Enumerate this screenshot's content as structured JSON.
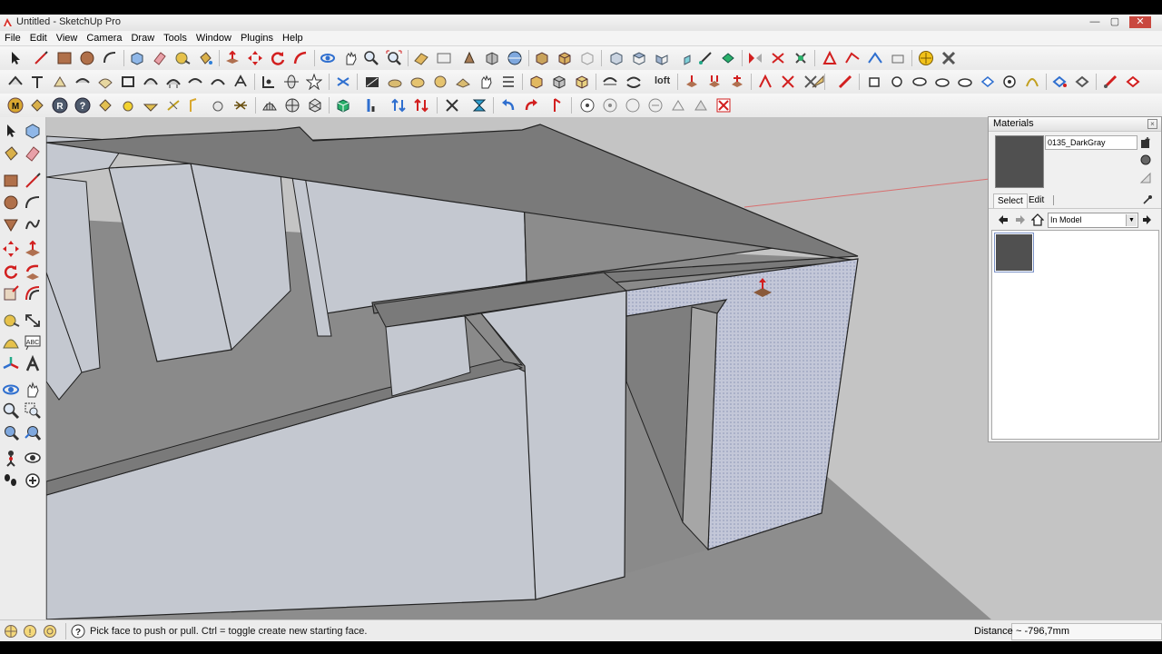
{
  "window": {
    "title": "Untitled - SketchUp Pro",
    "minimize": "—",
    "maximize": "▢",
    "close": "✕"
  },
  "menu": [
    "File",
    "Edit",
    "View",
    "Camera",
    "Draw",
    "Tools",
    "Window",
    "Plugins",
    "Help"
  ],
  "toolbar": {
    "loft_label": "loft"
  },
  "materials_panel": {
    "title": "Materials",
    "material_name": "0135_DarkGray",
    "tabs": [
      "Select",
      "Edit"
    ],
    "collection": "In Model",
    "swatch_color": "#505050"
  },
  "statusbar": {
    "hint": "Pick face to push or pull.  Ctrl = toggle create new starting face.",
    "measure_label": "Distance",
    "measure_value": "~ -796,7mm"
  },
  "colors": {
    "accent_red": "#d21f1f",
    "accent_blue": "#2f6fcf",
    "wall_face": "#c4c8d0",
    "floor": "#8c8c8c",
    "selected_face": "#c3c7d8"
  },
  "icons": {
    "toolbar_row1": [
      "select-icon",
      "line-icon",
      "rectangle-icon",
      "circle-icon",
      "arc-icon",
      "make-component-icon",
      "eraser-icon",
      "tape-measure-icon",
      "paint-bucket-icon",
      "push-pull-icon",
      "move-icon",
      "rotate-icon",
      "follow-me-icon",
      "orbit-icon",
      "pan-icon",
      "zoom-icon",
      "zoom-extents-icon",
      "section-icon",
      "scene-icon",
      "styles-icon",
      "components-icon",
      "shadows-icon",
      "fog-icon",
      "views-icon",
      "sandbox-icon",
      "solid-tools-icon",
      "compass-icon",
      "settings-icon"
    ],
    "left_tools": [
      "select-icon",
      "make-component-icon",
      "paint-bucket-icon",
      "eraser-icon",
      "rectangle-icon",
      "line-icon",
      "circle-icon",
      "arc-icon",
      "polygon-icon",
      "freehand-icon",
      "move-icon",
      "push-pull-icon",
      "rotate-icon",
      "follow-me-icon",
      "scale-icon",
      "offset-icon",
      "tape-measure-icon",
      "dimension-icon",
      "protractor-icon",
      "text-icon",
      "axes-icon",
      "3d-text-icon",
      "orbit-icon",
      "pan-icon",
      "zoom-icon",
      "zoom-window-icon",
      "zoom-extents-icon",
      "previous-view-icon",
      "position-camera-icon",
      "look-around-icon",
      "walk-icon",
      "section-plane-icon"
    ]
  }
}
